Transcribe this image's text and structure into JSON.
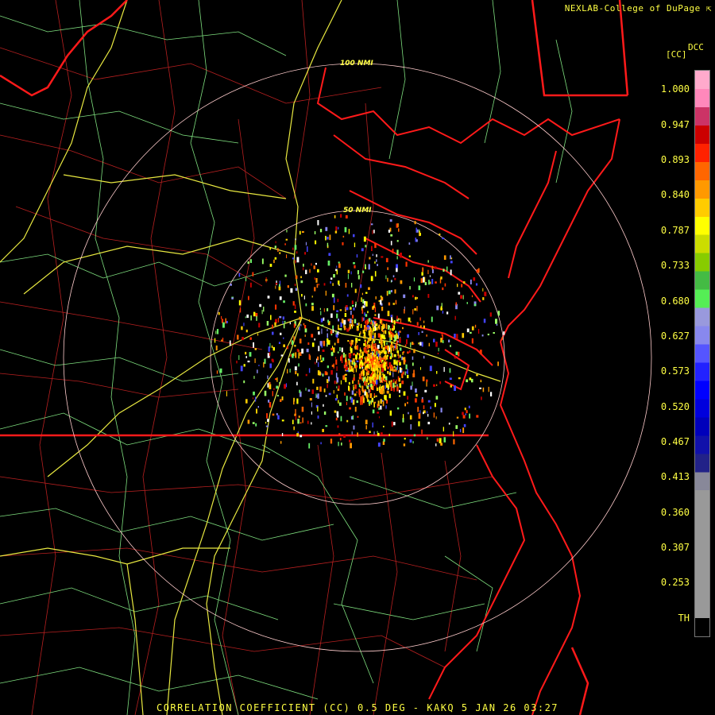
{
  "credit": "NEXLAB-College of DuPage",
  "colorbar": {
    "title": "DCC",
    "unit": "[CC]",
    "labels": [
      "1.000",
      "0.947",
      "0.893",
      "0.840",
      "0.787",
      "0.733",
      "0.680",
      "0.627",
      "0.573",
      "0.520",
      "0.467",
      "0.413",
      "0.360",
      "0.307",
      "0.253",
      "TH"
    ],
    "colors": [
      "#ffaacc",
      "#ff88bb",
      "#cc3366",
      "#cc0000",
      "#ff2200",
      "#ff6600",
      "#ff9900",
      "#ffcc00",
      "#ffff00",
      "#ccdd00",
      "#88cc00",
      "#44bb44",
      "#55ee55",
      "#9999dd",
      "#8888ee",
      "#5555ff",
      "#2222ff",
      "#0000ff",
      "#0000dd",
      "#0000bb",
      "#1111aa",
      "#222288",
      "#888899",
      "#999999",
      "#999999",
      "#999999",
      "#999999",
      "#999999",
      "#999999",
      "#999999",
      "#000000"
    ]
  },
  "rings": [
    {
      "label": "100 NMI",
      "radius_nmi": 100
    },
    {
      "label": "50 NMI",
      "radius_nmi": 50
    }
  ],
  "footer": "CORRELATION COEFFICIENT (CC) 0.5 DEG - KAKQ 5 JAN 26 03:27",
  "colors": {
    "background": "#000000",
    "state_line": "#ff2020",
    "county_line": "#cc2222",
    "highway": "#ffff44",
    "road": "#88ff88",
    "ring": "#ffcccc"
  }
}
